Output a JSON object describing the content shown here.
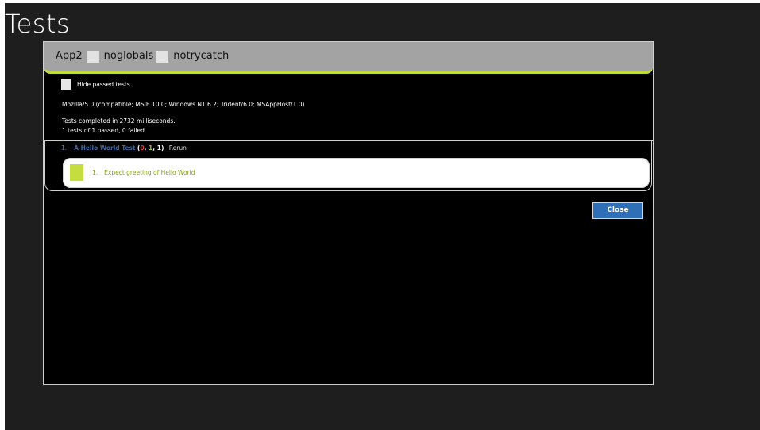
{
  "page": {
    "title": "Tests"
  },
  "dialog": {
    "header": {
      "app_name": "App2",
      "option1_label": "noglobals",
      "option2_label": "notrycatch"
    },
    "filter": {
      "hide_passed_label": "Hide passed tests"
    },
    "user_agent": "Mozilla/5.0 (compatible; MSIE 10.0; Windows NT 6.2; Trident/6.0; MSAppHost/1.0)",
    "results": {
      "line1": "Tests completed in 2732 milliseconds.",
      "line2": "1 tests of 1 passed, 0 failed."
    },
    "tests": [
      {
        "number": "1.",
        "name": "A Hello World Test",
        "open_paren": "(",
        "failed": "0",
        "sep1": ", ",
        "passed": "1",
        "sep2": ", ",
        "total": "1",
        "close_paren": ")",
        "rerun_label": "Rerun",
        "assertions": [
          {
            "number": "1.",
            "text": "Expect greeting of Hello World"
          }
        ]
      }
    ],
    "close_label": "Close"
  },
  "colors": {
    "accent": "#c0db3a",
    "header_bg": "#a3a3a3",
    "button_blue": "#2f6fb8",
    "failed_red": "#e23b3b",
    "passed_green": "#9bc33a",
    "test_name_blue": "#3e66a3"
  }
}
